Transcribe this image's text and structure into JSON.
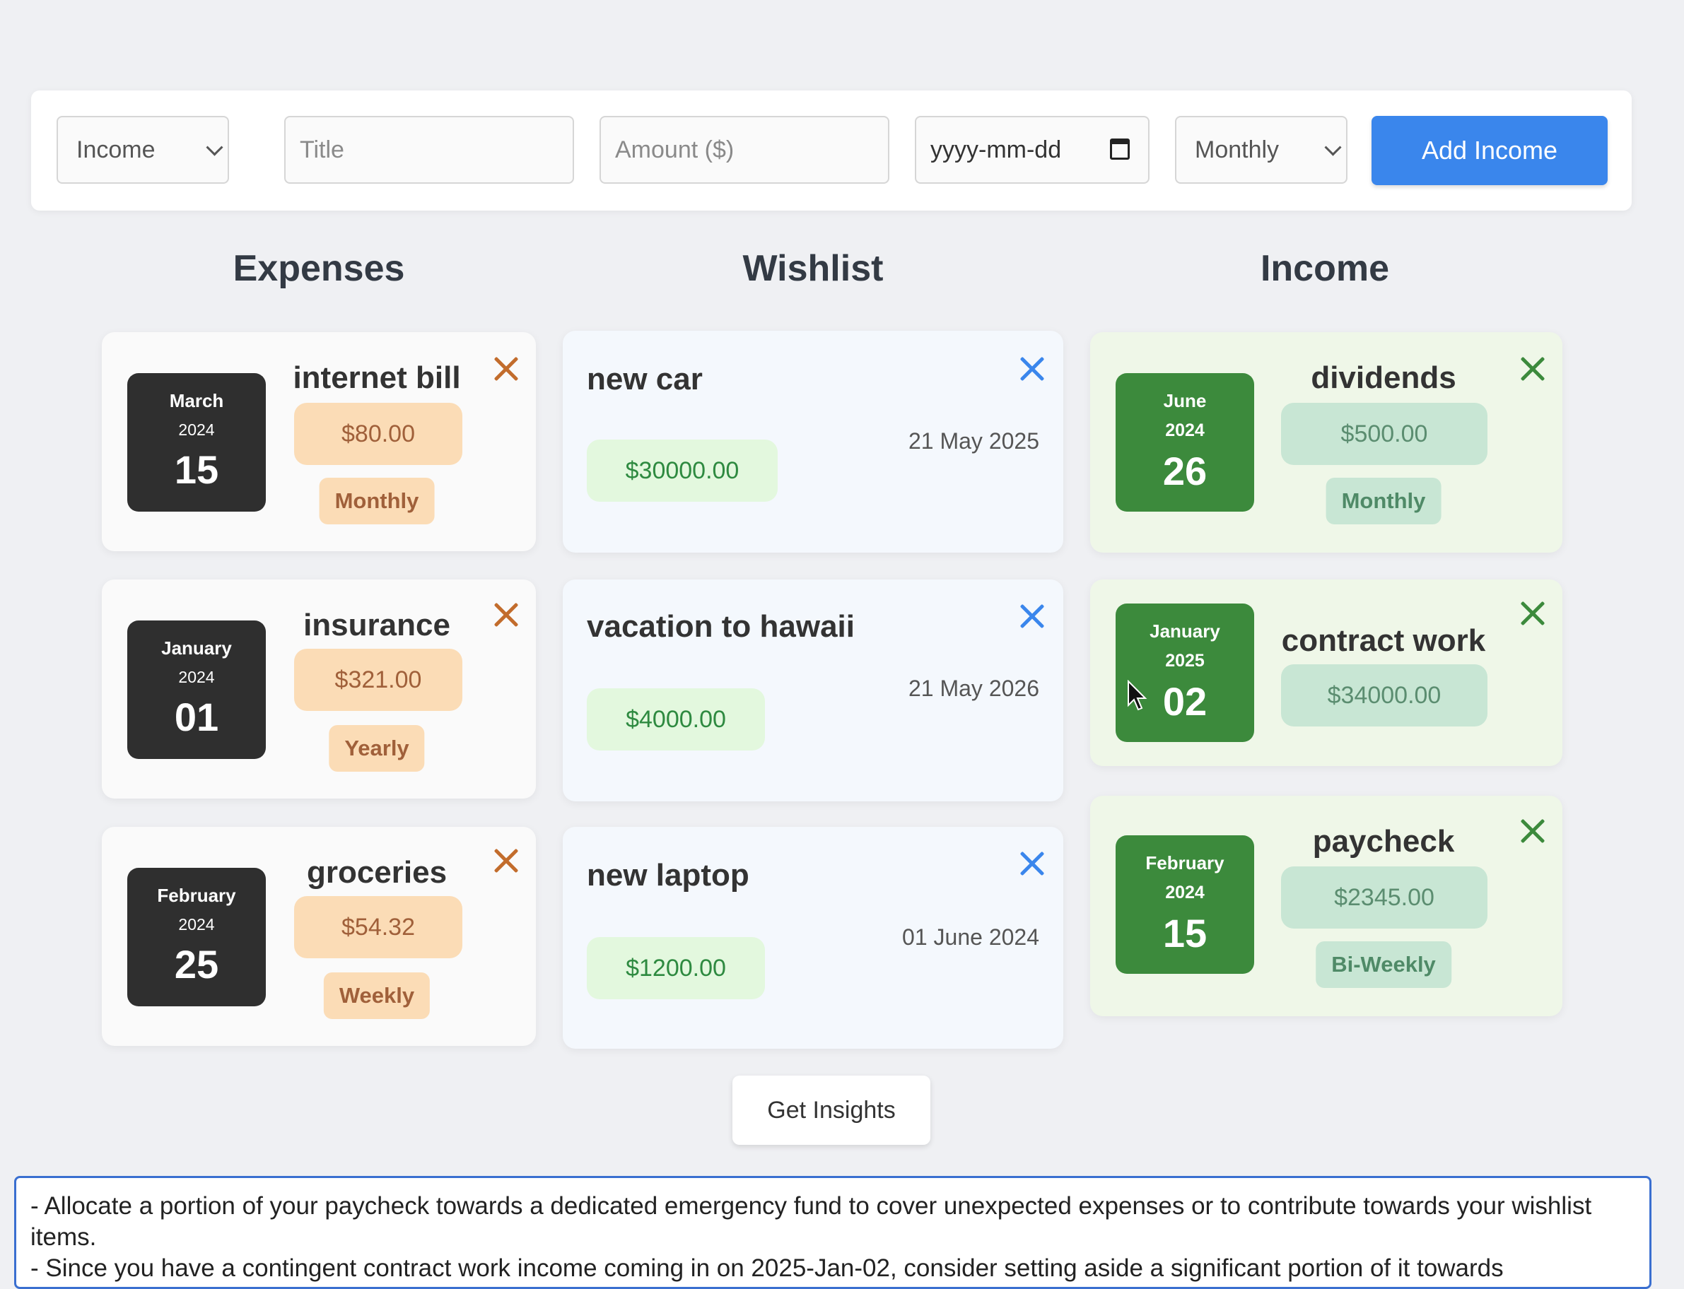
{
  "form": {
    "type_select": "Income",
    "title_placeholder": "Title",
    "amount_placeholder": "Amount ($)",
    "date_placeholder": "yyyy-mm-dd",
    "frequency_select": "Monthly",
    "add_button": "Add Income"
  },
  "columns": {
    "expenses": "Expenses",
    "wishlist": "Wishlist",
    "income": "Income"
  },
  "expenses": [
    {
      "month": "March",
      "year": "2024",
      "day": "15",
      "title": "internet bill",
      "amount": "$80.00",
      "frequency": "Monthly"
    },
    {
      "month": "January",
      "year": "2024",
      "day": "01",
      "title": "insurance",
      "amount": "$321.00",
      "frequency": "Yearly"
    },
    {
      "month": "February",
      "year": "2024",
      "day": "25",
      "title": "groceries",
      "amount": "$54.32",
      "frequency": "Weekly"
    }
  ],
  "wishlist": [
    {
      "title": "new car",
      "amount": "$30000.00",
      "date": "21 May 2025"
    },
    {
      "title": "vacation to hawaii",
      "amount": "$4000.00",
      "date": "21 May 2026"
    },
    {
      "title": "new laptop",
      "amount": "$1200.00",
      "date": "01 June 2024"
    }
  ],
  "income": [
    {
      "month": "June",
      "year": "2024",
      "day": "26",
      "title": "dividends",
      "amount": "$500.00",
      "frequency": "Monthly"
    },
    {
      "month": "January",
      "year": "2025",
      "day": "02",
      "title": "contract work",
      "amount": "$34000.00",
      "frequency": ""
    },
    {
      "month": "February",
      "year": "2024",
      "day": "15",
      "title": "paycheck",
      "amount": "$2345.00",
      "frequency": "Bi-Weekly"
    }
  ],
  "insights": {
    "button": "Get Insights",
    "line1": "- Allocate a portion of your paycheck towards a dedicated emergency fund to cover unexpected expenses or to contribute towards your wishlist items.",
    "line2": "- Since you have a contingent contract work income coming in on 2025-Jan-02, consider setting aside a significant portion of it towards"
  },
  "colors": {
    "accent_blue": "#3a86ec",
    "expense_date": "#2f2f2f",
    "income_date": "#3c8a3c",
    "expense_badge": "#fbdcb6",
    "income_badge": "#c8e6d4",
    "wish_badge": "#e3f8de"
  },
  "icons": {
    "close": "close-icon",
    "chevron": "chevron-down-icon",
    "calendar": "calendar-icon",
    "cursor": "mouse-pointer-icon"
  }
}
